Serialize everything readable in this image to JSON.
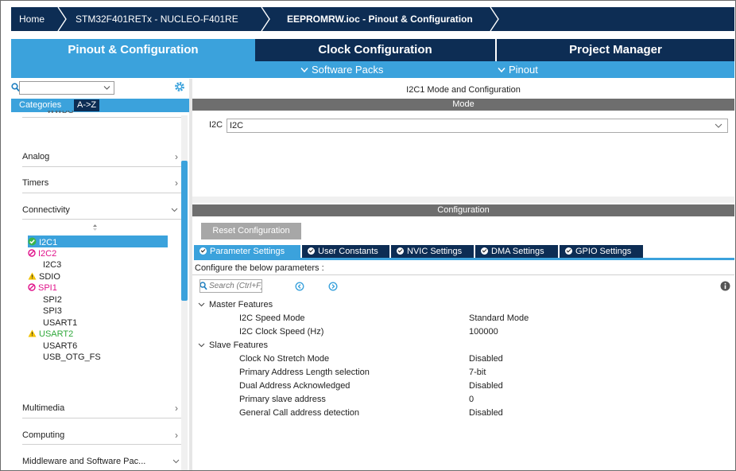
{
  "breadcrumb": {
    "home": "Home",
    "device": "STM32F401RETx  -  NUCLEO-F401RE",
    "file": "EEPROMRW.ioc - Pinout & Configuration"
  },
  "main_tabs": [
    "Pinout & Configuration",
    "Clock Configuration",
    "Project Manager"
  ],
  "sub_tabs": {
    "software_packs": "Software Packs",
    "pinout": "Pinout"
  },
  "left_panel": {
    "search_value": "",
    "tabs": [
      "Categories",
      "A->Z"
    ],
    "clipped_category": "WWDG",
    "categories": [
      "Analog",
      "Timers",
      "Connectivity",
      "Multimedia",
      "Computing",
      "Middleware and Software Pac..."
    ],
    "peripherals": [
      {
        "name": "I2C1",
        "status": "ok"
      },
      {
        "name": "I2C2",
        "status": "blocked"
      },
      {
        "name": "I2C3",
        "status": "none"
      },
      {
        "name": "SDIO",
        "status": "warning"
      },
      {
        "name": "SPI1",
        "status": "blocked"
      },
      {
        "name": "SPI2",
        "status": "none"
      },
      {
        "name": "SPI3",
        "status": "none"
      },
      {
        "name": "USART1",
        "status": "none"
      },
      {
        "name": "USART2",
        "status": "warning"
      },
      {
        "name": "USART6",
        "status": "none"
      },
      {
        "name": "USB_OTG_FS",
        "status": "none"
      }
    ]
  },
  "right_panel": {
    "title": "I2C1 Mode and Configuration",
    "mode_header": "Mode",
    "mode_label": "I2C",
    "mode_value": "I2C",
    "config_header": "Configuration",
    "reset_button": "Reset Configuration",
    "param_tabs": [
      "Parameter Settings",
      "User Constants",
      "NVIC Settings",
      "DMA Settings",
      "GPIO Settings"
    ],
    "configure_text": "Configure the below parameters :",
    "search_placeholder": "Search (Ctrl+F)",
    "groups": [
      {
        "name": "Master Features",
        "params": [
          {
            "name": "I2C Speed Mode",
            "value": "Standard Mode"
          },
          {
            "name": "I2C Clock Speed (Hz)",
            "value": "100000"
          }
        ]
      },
      {
        "name": "Slave Features",
        "params": [
          {
            "name": "Clock No Stretch Mode",
            "value": "Disabled"
          },
          {
            "name": "Primary Address Length selection",
            "value": "7-bit"
          },
          {
            "name": "Dual Address Acknowledged",
            "value": "Disabled"
          },
          {
            "name": "Primary slave address",
            "value": "0"
          },
          {
            "name": "General Call address detection",
            "value": "Disabled"
          }
        ]
      }
    ]
  },
  "colors": {
    "navy": "#0d2d54",
    "accent_blue": "#3ba2dc",
    "ok_green": "#3cb44b",
    "blocked_pink": "#e0128a",
    "warning_yellow": "#f2c200",
    "warning_text_green": "#2fa83a",
    "header_grey": "#6e6e6e",
    "tab_dark": "#0d2d54"
  }
}
